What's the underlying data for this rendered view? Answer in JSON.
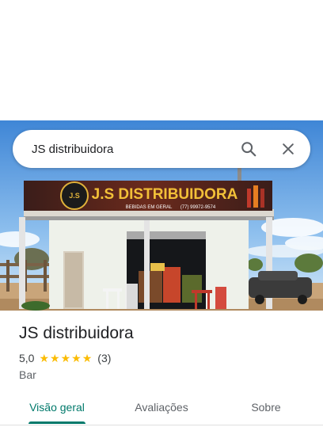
{
  "search": {
    "query": "JS distribuidora"
  },
  "photo": {
    "sign_title": "J.S DISTRIBUIDORA",
    "sign_subtitle": "BEBIDAS EM GERAL",
    "sign_phone": "(77) 99972-9574",
    "logo_text": "J.S"
  },
  "place": {
    "name": "JS distribuidora",
    "rating": "5,0",
    "stars": 5,
    "review_count": "(3)",
    "category": "Bar"
  },
  "tabs": [
    {
      "label": "Visão geral",
      "active": true
    },
    {
      "label": "Avaliações",
      "active": false
    },
    {
      "label": "Sobre",
      "active": false
    }
  ],
  "colors": {
    "accent": "#00796b",
    "star": "#fbbc04"
  },
  "icons": {
    "search": "search-icon",
    "close": "close-icon",
    "star": "star-icon"
  }
}
